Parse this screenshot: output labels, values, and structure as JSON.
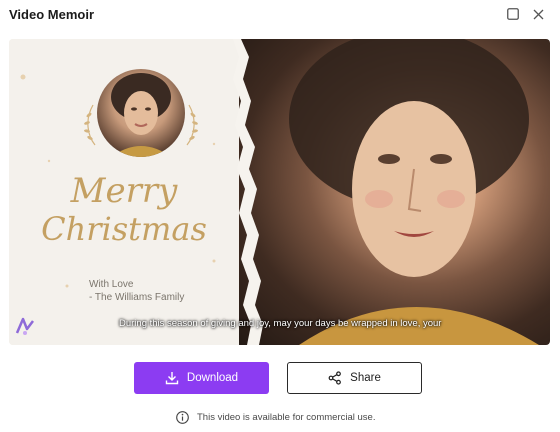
{
  "window": {
    "title": "Video Memoir",
    "maximize_icon": "maximize-icon",
    "close_icon": "close-icon"
  },
  "preview": {
    "greeting_line1": "Merry",
    "greeting_line2": "Christmas",
    "signoff_line1": "With Love",
    "signoff_line2": "- The Williams Family",
    "caption": "During this season of giving and joy, may your days be wrapped in love, your",
    "accent_gold": "#c4a062"
  },
  "actions": {
    "download_label": "Download",
    "download_icon": "download-icon",
    "download_color": "#8c3cf2",
    "share_label": "Share",
    "share_icon": "share-icon"
  },
  "footer": {
    "notice": "This video is available for commercial use.",
    "info_icon": "info-icon"
  }
}
